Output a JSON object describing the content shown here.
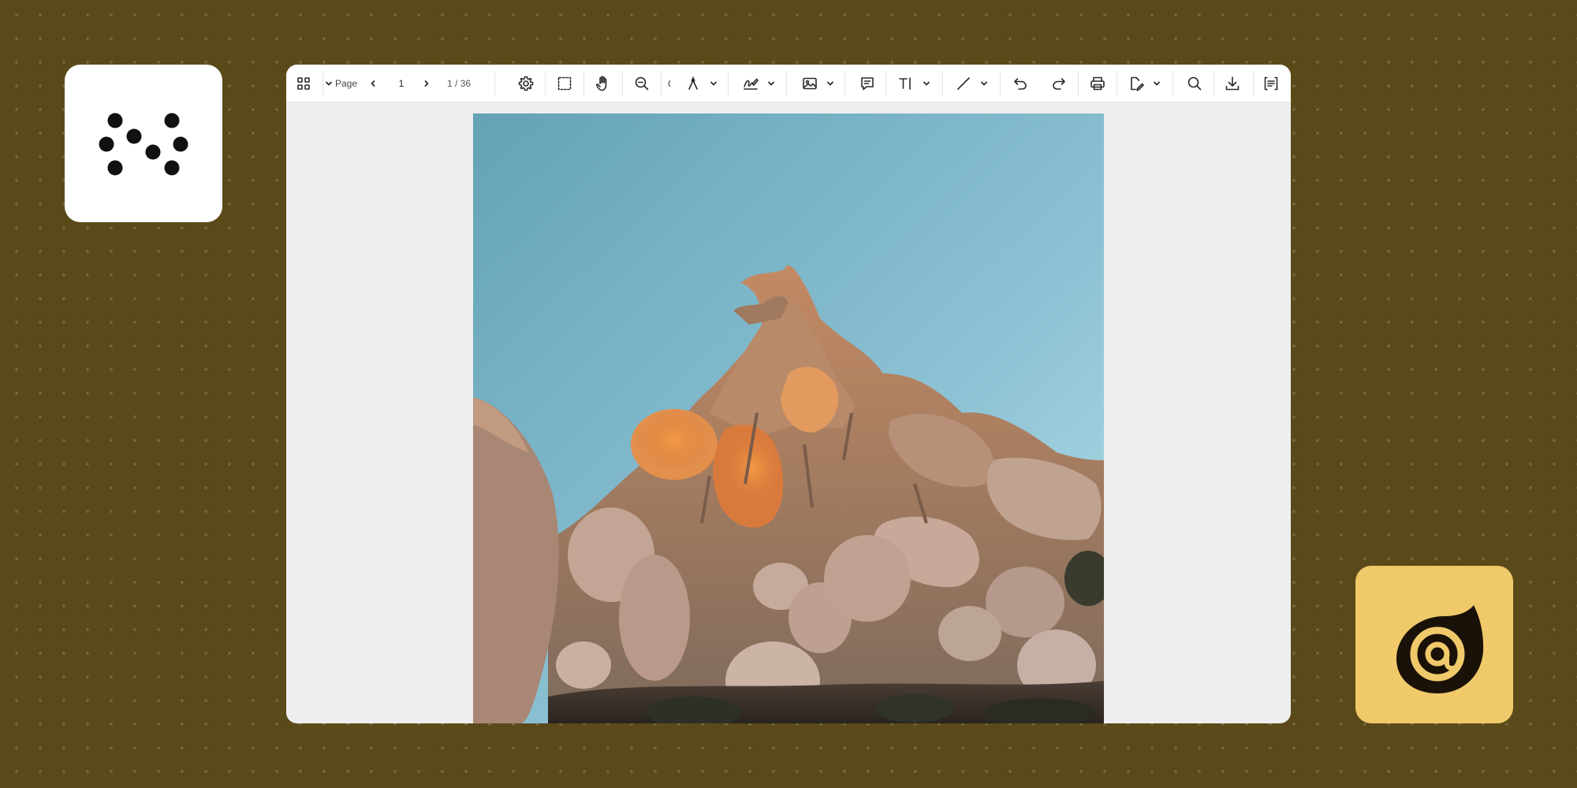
{
  "toolbar": {
    "page_label": "Page",
    "current_page": "1",
    "page_count": "1 / 36",
    "tools": [
      {
        "name": "thumbnails",
        "icon": "grid-icon"
      },
      {
        "name": "previous-page",
        "icon": "chevron-left-icon"
      },
      {
        "name": "next-page",
        "icon": "chevron-right-icon"
      },
      {
        "name": "settings",
        "icon": "gear-icon"
      },
      {
        "name": "selection",
        "icon": "dashed-rectangle-icon"
      },
      {
        "name": "pan",
        "icon": "hand-icon"
      },
      {
        "name": "zoom-out",
        "icon": "zoom-out-icon"
      },
      {
        "name": "draw",
        "icon": "pen-nib-icon"
      },
      {
        "name": "signature",
        "icon": "signature-icon"
      },
      {
        "name": "image",
        "icon": "image-icon"
      },
      {
        "name": "comment",
        "icon": "comment-icon"
      },
      {
        "name": "text",
        "icon": "text-cursor-icon"
      },
      {
        "name": "shapes",
        "icon": "line-icon"
      },
      {
        "name": "undo",
        "icon": "undo-icon"
      },
      {
        "name": "redo",
        "icon": "redo-icon"
      },
      {
        "name": "print",
        "icon": "printer-icon"
      },
      {
        "name": "edit",
        "icon": "pencil-page-icon"
      },
      {
        "name": "search",
        "icon": "search-icon"
      },
      {
        "name": "download",
        "icon": "download-icon"
      },
      {
        "name": "form-fields",
        "icon": "form-fields-icon"
      }
    ]
  },
  "document": {
    "page_content": "rock-formation-photo"
  },
  "branding": {
    "left_logo": "dots-logo-icon",
    "right_logo": "blazor-at-logo-icon",
    "right_logo_background": "#f0c96a",
    "page_background": "#5b4a19"
  }
}
